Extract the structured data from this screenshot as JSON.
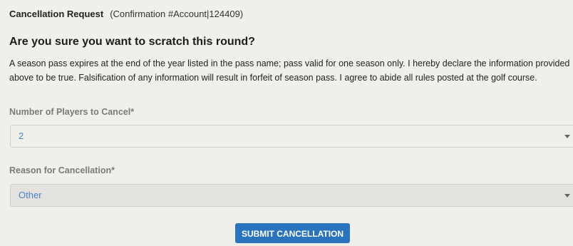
{
  "header": {
    "title": "Cancellation Request",
    "confirmation": "(Confirmation #Account|124409)"
  },
  "question": "Are you sure you want to scratch this round?",
  "notice": "A season pass expires at the end of the year listed in the pass name; pass valid for one season only. I hereby declare the information provided above to be true. Falsification of any information will result in forfeit of season pass. I agree to abide all rules posted at the golf course.",
  "players": {
    "label": "Number of Players to Cancel*",
    "value": "2"
  },
  "reason": {
    "label": "Reason for Cancellation*",
    "value": "Other"
  },
  "submit_label": "SUBMIT CANCELLATION",
  "colors": {
    "accent": "#2a73bd",
    "select_text": "#4a86c8",
    "background": "#f1efea"
  }
}
